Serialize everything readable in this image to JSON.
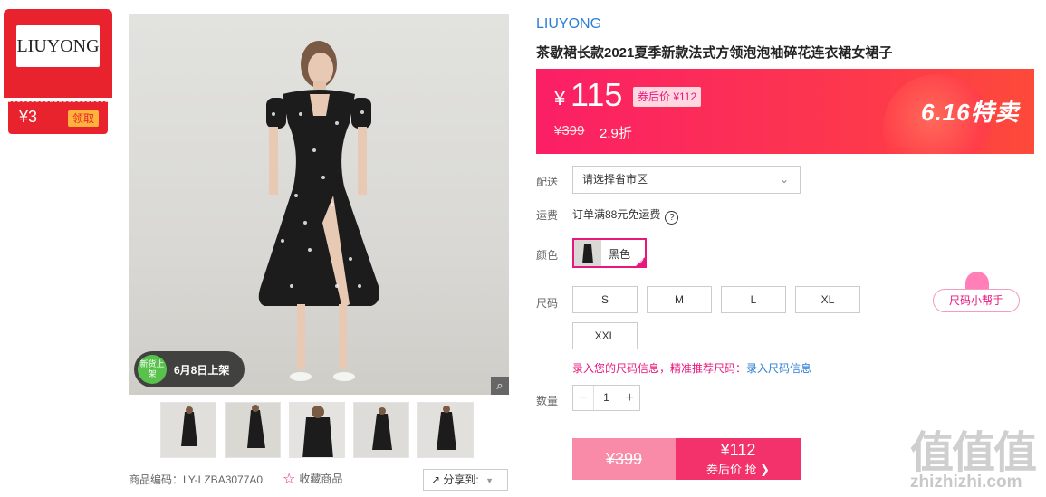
{
  "badge": {
    "logo_text": "LIUYONG",
    "coupon_amount": "¥3",
    "coupon_action": "领取"
  },
  "gallery": {
    "new_tag": "新货上架",
    "launch_text": "6月8日上架",
    "zoom_icon": "magnifier-icon",
    "thumbnails": [
      "thumb-1",
      "thumb-2",
      "thumb-3",
      "thumb-4",
      "thumb-5"
    ]
  },
  "meta": {
    "sku": "商品编码：LY-LZBA3077A0",
    "favorite": "收藏商品",
    "share": "分享到:"
  },
  "product": {
    "brand": "LIUYONG",
    "title": "茶歇裙长款2021夏季新款法式方领泡泡袖碎花连衣裙女裙子"
  },
  "price": {
    "currency": "¥",
    "current": "115",
    "after_coupon": "券后价 ¥112",
    "original": "¥399",
    "discount": "2.9折",
    "promo": "6.16特卖"
  },
  "options": {
    "delivery_label": "配送",
    "delivery_placeholder": "请选择省市区",
    "shipping_label": "运费",
    "shipping_text": "订单满88元免运费",
    "color_label": "颜色",
    "color_value": "黑色",
    "size_label": "尺码",
    "sizes": [
      "S",
      "M",
      "L",
      "XL",
      "XXL"
    ],
    "size_helper": "尺码小帮手",
    "size_info": "录入您的尺码信息，精准推荐尺码：",
    "size_info_link": "录入尺码信息",
    "qty_label": "数量",
    "qty_value": "1"
  },
  "buy": {
    "original": "¥399",
    "price": "¥112",
    "action": "券后价 抢 ❯"
  },
  "watermark": {
    "big": "值值值",
    "small": "zhizhizhi.com"
  },
  "colors": {
    "accent": "#e8177d",
    "brand_red": "#e8232e",
    "link": "#2d7ed6"
  }
}
